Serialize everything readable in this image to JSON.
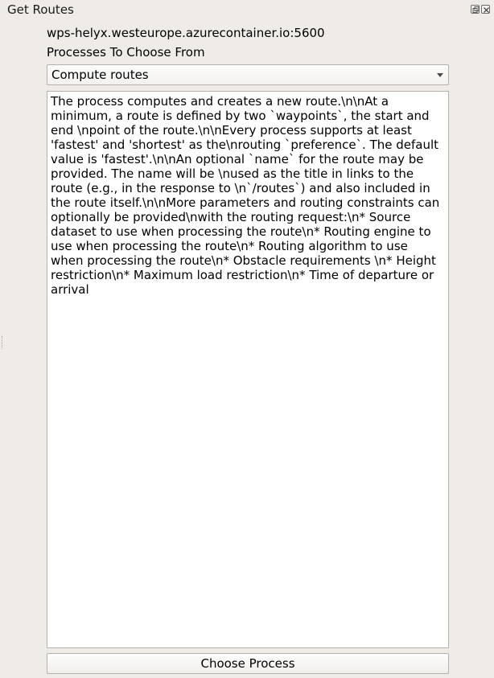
{
  "window": {
    "title": "Get Routes",
    "float_icon": "float-window-icon",
    "close_icon": "close-icon"
  },
  "server": {
    "url": "wps-helyx.westeurope.azurecontainer.io:5600"
  },
  "processes": {
    "label": "Processes To Choose From",
    "selected": "Compute routes",
    "dropdown_icon": "chevron-down-icon"
  },
  "description": {
    "lines": [
      "The process computes and creates a new route.\\n\\nAt a",
      "minimum, a route is defined by two `waypoints`, the start and",
      "end \\npoint of the route.\\n\\nEvery process supports at least",
      "'fastest' and 'shortest' as the\\nrouting `preference`. The default",
      "value is 'fastest'.\\n\\nAn optional `name` for the route may be",
      "provided. The name will be \\nused as the title in links to the",
      "route (e.g., in the response to \\n`/routes`) and also included in",
      "the route itself.\\n\\nMore parameters and routing constraints can",
      "optionally be provided\\nwith the routing request:\\n* Source",
      "dataset to use when processing the route\\n* Routing engine to",
      "use when processing the route\\n* Routing algorithm to use",
      "when processing the route\\n* Obstacle requirements \\n* Height",
      "restriction\\n* Maximum load restriction\\n* Time of departure or",
      "arrival"
    ]
  },
  "actions": {
    "choose_label": "Choose Process"
  },
  "colors": {
    "background": "#efebe7",
    "field_border": "#b5b1ac",
    "text_area": "#ffffff"
  }
}
